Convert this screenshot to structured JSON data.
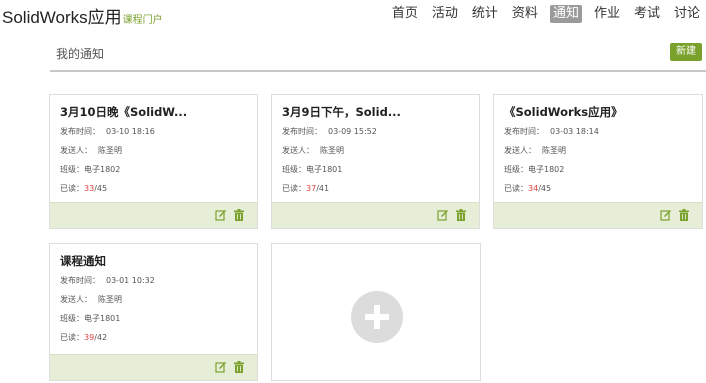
{
  "header": {
    "brand": "SolidWorks应用",
    "brand_sub": "课程门户",
    "nav": [
      "首页",
      "活动",
      "统计",
      "资料",
      "通知",
      "作业",
      "考试",
      "讨论"
    ],
    "active_nav": "通知"
  },
  "section": {
    "title": "我的通知",
    "new_button": "新建"
  },
  "labels": {
    "published": "发布时间：",
    "sender": "发送人：",
    "class": "班级：",
    "read": "已读："
  },
  "cards": [
    {
      "title": "3月10日晚《SolidW...",
      "published": "03-10 18:16",
      "sender": "陈圣明",
      "class": "电子1802",
      "read": "33",
      "total": "/45"
    },
    {
      "title": "3月9日下午，Solid...",
      "published": "03-09 15:52",
      "sender": "陈圣明",
      "class": "电子1801",
      "read": "37",
      "total": "/41"
    },
    {
      "title": "《SolidWorks应用》",
      "published": "03-03 18:14",
      "sender": "陈圣明",
      "class": "电子1802",
      "read": "34",
      "total": "/45"
    },
    {
      "title": "课程通知",
      "published": "03-01 10:32",
      "sender": "陈圣明",
      "class": "电子1801",
      "read": "39",
      "total": "/42"
    }
  ],
  "colors": {
    "accent": "#7aa12c",
    "footer": "#e7eed8",
    "read": "#e04040",
    "active_tab": "#9a9a9a"
  },
  "icons": {
    "edit": "edit-icon",
    "delete": "trash-icon",
    "add": "plus-icon"
  }
}
